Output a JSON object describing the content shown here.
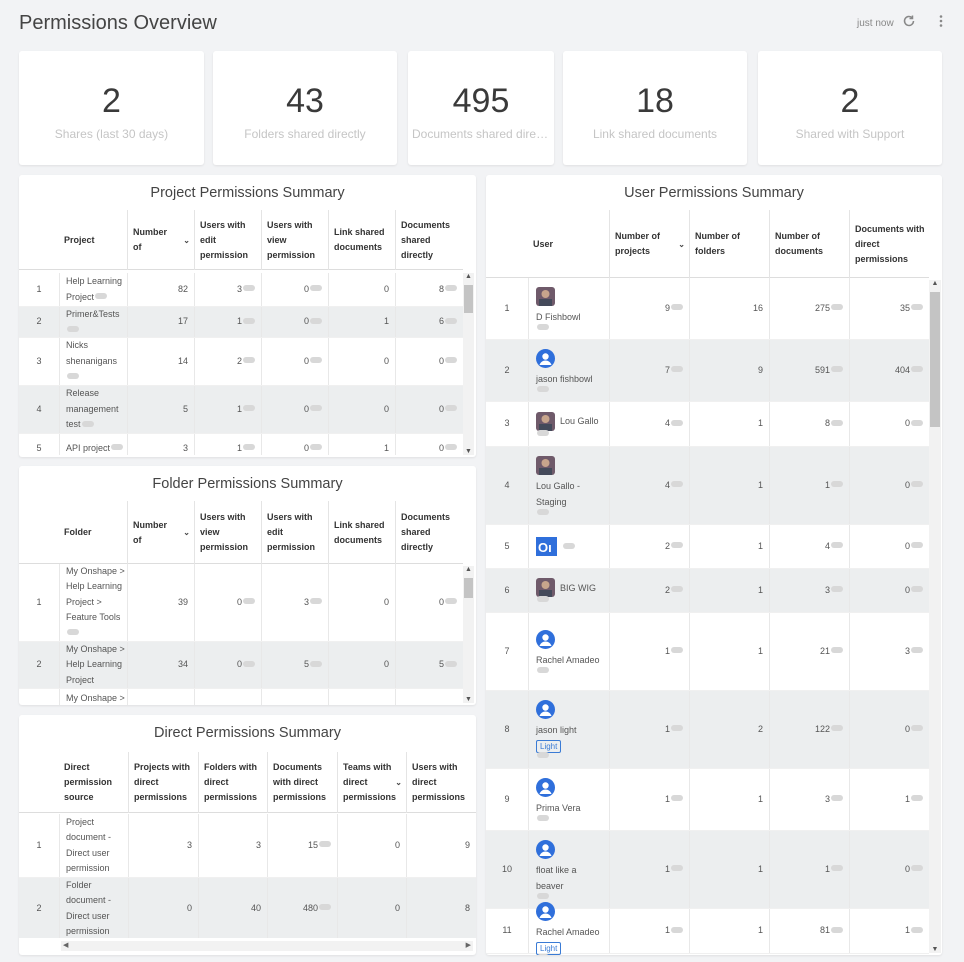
{
  "header": {
    "title": "Permissions Overview",
    "status": "just now",
    "refresh_icon": "refresh-icon",
    "menu_icon": "more-vert-icon"
  },
  "kpis": [
    {
      "value": "2",
      "label": "Shares (last 30 days)"
    },
    {
      "value": "43",
      "label": "Folders shared directly"
    },
    {
      "value": "495",
      "label": "Documents shared directly"
    },
    {
      "value": "18",
      "label": "Link shared documents"
    },
    {
      "value": "2",
      "label": "Shared with Support"
    }
  ],
  "project_panel": {
    "title": "Project Permissions Summary",
    "columns": [
      "Project",
      "Number of documents",
      "Users with edit permission",
      "Users with view permission",
      "Link shared documents",
      "Documents shared directly"
    ],
    "rows": [
      [
        "1",
        "Help Learning Project",
        "82",
        "3",
        "0",
        "0",
        "8"
      ],
      [
        "2",
        "Primer&Tests",
        "17",
        "1",
        "0",
        "1",
        "6"
      ],
      [
        "3",
        "Nicks shenanigans",
        "14",
        "2",
        "0",
        "0",
        "0"
      ],
      [
        "4",
        "Release management test",
        "5",
        "1",
        "0",
        "0",
        "0"
      ],
      [
        "5",
        "API project",
        "3",
        "1",
        "0",
        "1",
        "0"
      ]
    ]
  },
  "folder_panel": {
    "title": "Folder Permissions Summary",
    "columns": [
      "Folder",
      "Number of documents",
      "Users with view permission",
      "Users with edit permission",
      "Link shared documents",
      "Documents shared directly"
    ],
    "rows": [
      [
        "1",
        "My Onshape > Help Learning Project > Feature Tools",
        "39",
        "0",
        "3",
        "0",
        "0"
      ],
      [
        "2",
        "My Onshape > Help Learning Project",
        "34",
        "0",
        "5",
        "0",
        "5"
      ],
      [
        "",
        "My Onshape >",
        "",
        "",
        "",
        "",
        ""
      ]
    ]
  },
  "direct_panel": {
    "title": "Direct Permissions Summary",
    "columns": [
      "Direct permission source",
      "Projects with direct permissions",
      "Folders with direct permissions",
      "Documents with direct permissions",
      "Teams with direct permissions",
      "Users with direct permissions"
    ],
    "rows": [
      [
        "1",
        "Project document - Direct user permission",
        "3",
        "3",
        "15",
        "0",
        "9"
      ],
      [
        "2",
        "Folder document - Direct user permission",
        "0",
        "40",
        "480",
        "0",
        "8"
      ]
    ]
  },
  "user_panel": {
    "title": "User Permissions Summary",
    "columns": [
      "User",
      "Number of projects",
      "Number of folders",
      "Number of documents",
      "Documents with direct permissions"
    ],
    "rows": [
      {
        "idx": "1",
        "name": "D Fishbowl",
        "avatar": "photo",
        "projects": "9",
        "folders": "16",
        "documents": "275",
        "direct": "35",
        "badge": ""
      },
      {
        "idx": "2",
        "name": "jason fishbowl",
        "avatar": "default",
        "projects": "7",
        "folders": "9",
        "documents": "591",
        "direct": "404",
        "badge": ""
      },
      {
        "idx": "3",
        "name": "Lou Gallo",
        "avatar": "photo",
        "projects": "4",
        "folders": "1",
        "documents": "8",
        "direct": "0",
        "badge": ""
      },
      {
        "idx": "4",
        "name": "Lou Gallo - Staging",
        "avatar": "photo",
        "projects": "4",
        "folders": "1",
        "documents": "1",
        "direct": "0",
        "badge": ""
      },
      {
        "idx": "5",
        "name": "",
        "avatar": "logo",
        "projects": "2",
        "folders": "1",
        "documents": "4",
        "direct": "0",
        "badge": ""
      },
      {
        "idx": "6",
        "name": "BIG WIG",
        "avatar": "photo",
        "projects": "2",
        "folders": "1",
        "documents": "3",
        "direct": "0",
        "badge": ""
      },
      {
        "idx": "7",
        "name": "Rachel Amadeo",
        "avatar": "default",
        "projects": "1",
        "folders": "1",
        "documents": "21",
        "direct": "3",
        "badge": ""
      },
      {
        "idx": "8",
        "name": "jason light",
        "avatar": "default",
        "projects": "1",
        "folders": "2",
        "documents": "122",
        "direct": "0",
        "badge": "Light"
      },
      {
        "idx": "9",
        "name": "Prima Vera",
        "avatar": "default",
        "projects": "1",
        "folders": "1",
        "documents": "3",
        "direct": "1",
        "badge": ""
      },
      {
        "idx": "10",
        "name": "float like a beaver",
        "avatar": "default",
        "projects": "1",
        "folders": "1",
        "documents": "1",
        "direct": "0",
        "badge": ""
      },
      {
        "idx": "11",
        "name": "Rachel Amadeo",
        "avatar": "default",
        "projects": "1",
        "folders": "1",
        "documents": "81",
        "direct": "1",
        "badge": "Light"
      }
    ]
  },
  "colors": {
    "background": "#f2f3f5",
    "card": "#ffffff",
    "alt_row": "#eceeef",
    "badge": "#3a7bd5",
    "avatar": "#2f6fdb"
  }
}
